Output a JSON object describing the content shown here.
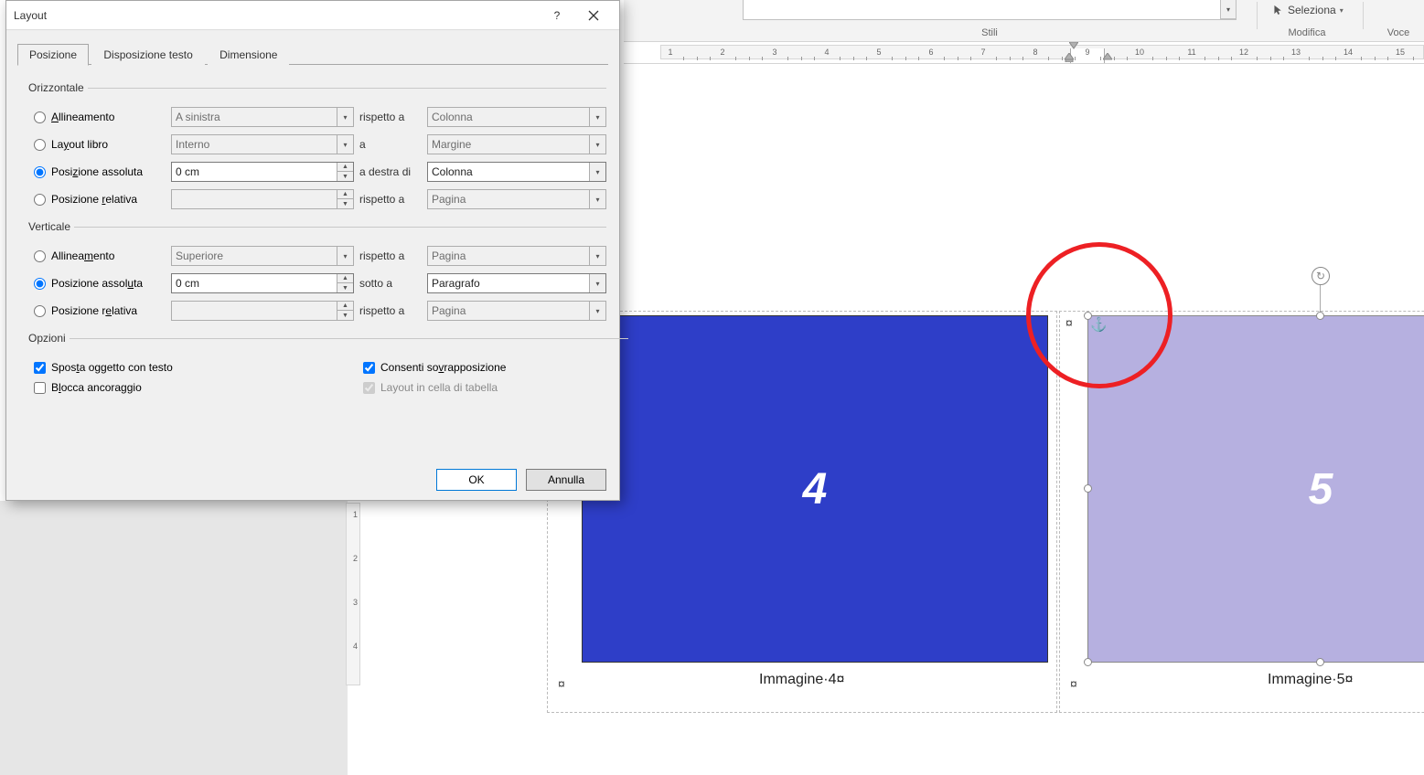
{
  "ribbon": {
    "group_stili": "Stili",
    "group_modifica": "Modifica",
    "group_voce": "Voce",
    "seleziona": "Seleziona"
  },
  "ruler": {
    "numbers": [
      "1",
      "2",
      "3",
      "4",
      "5",
      "6",
      "7",
      "8",
      "9",
      "10",
      "11",
      "12",
      "13",
      "14",
      "15"
    ]
  },
  "v_ruler": {
    "numbers": [
      "1",
      "2",
      "3",
      "4"
    ]
  },
  "document": {
    "img4_label": "4",
    "img5_label": "5",
    "caption4": "Immagine·4¤",
    "caption5": "Immagine·5¤",
    "cell_mark": "¤"
  },
  "dialog": {
    "title": "Layout",
    "help": "?",
    "tabs": {
      "posizione": "Posizione",
      "disposizione": "Disposizione testo",
      "dimensione": "Dimensione"
    },
    "horiz": {
      "legend": "Orizzontale",
      "allineamento": "Allineamento",
      "allineamento_key": "A",
      "layout_libro_pre": "La",
      "layout_libro_key": "y",
      "layout_libro_post": "out libro",
      "pos_assoluta_pre": "Posi",
      "pos_assoluta_key": "z",
      "pos_assoluta_post": "ione assoluta",
      "pos_relativa_pre": "Posizione ",
      "pos_relativa_key": "r",
      "pos_relativa_post": "elativa",
      "rispetto_a": "rispetto a",
      "a": "a",
      "a_destra_di": "a destra di",
      "a_sinistra": "A sinistra",
      "interno": "Interno",
      "zero_cm": "0 cm",
      "colonna": "Colonna",
      "margine": "Margine",
      "pagina": "Pagina"
    },
    "vert": {
      "legend": "Verticale",
      "allineamento_pre": "Allinea",
      "allineamento_key": "m",
      "allineamento_post": "ento",
      "pos_assoluta_pre": "Posizione assol",
      "pos_assoluta_key": "u",
      "pos_assoluta_post": "ta",
      "pos_relativa_pre": "Posizione r",
      "pos_relativa_key": "e",
      "pos_relativa_post": "lativa",
      "superiore": "Superiore",
      "zero_cm": "0 cm",
      "rispetto_a": "rispetto a",
      "sotto_a": "sotto a",
      "pagina": "Pagina",
      "paragrafo": "Paragrafo"
    },
    "opzioni": {
      "legend": "Opzioni",
      "sposta_pre": "Spos",
      "sposta_key": "t",
      "sposta_post": "a oggetto con testo",
      "blocca_pre": "B",
      "blocca_key": "l",
      "blocca_post": "occa ancoraggio",
      "consenti_pre": "Consenti so",
      "consenti_key": "v",
      "consenti_post": "rapposizione",
      "layout_cella": "Layout in cella di tabella"
    },
    "buttons": {
      "ok": "OK",
      "annulla": "Annulla"
    }
  }
}
